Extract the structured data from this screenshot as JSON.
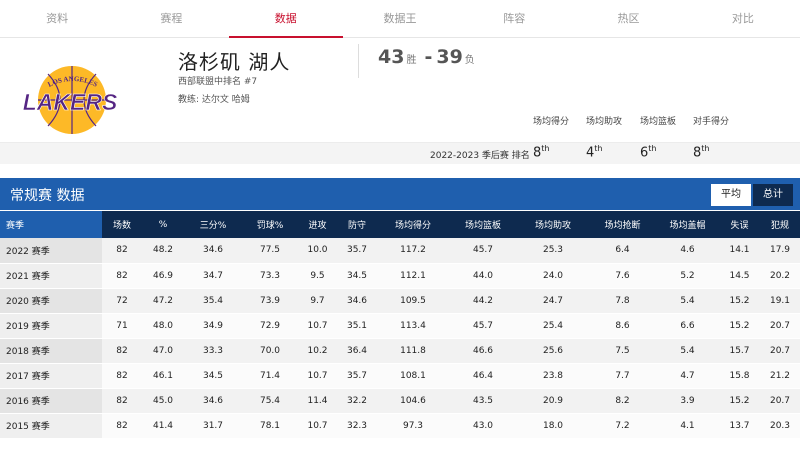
{
  "nav": {
    "tabs": [
      {
        "label": "资料"
      },
      {
        "label": "赛程"
      },
      {
        "label": "数据"
      },
      {
        "label": "数据王"
      },
      {
        "label": "阵容"
      },
      {
        "label": "热区"
      },
      {
        "label": "对比"
      }
    ],
    "active_index": 2
  },
  "header": {
    "team_name": "洛杉矶 湖人",
    "conference_rank": "西部联盟中排名 #7",
    "coach": "教练: 达尔文 哈姆",
    "wins": "43",
    "wins_unit": "胜",
    "separator": "-",
    "losses": "39",
    "losses_unit": "负",
    "logo_text_top": "LOS ANGELES",
    "logo_text_main": "LAKERS",
    "colors": {
      "accent": "#c8102e",
      "purple": "#552583",
      "gold": "#fdb927"
    }
  },
  "rankings": {
    "season_label": "2022-2023 季后赛 排名",
    "headers": [
      "场均得分",
      "场均助攻",
      "场均篮板",
      "对手得分"
    ],
    "values": [
      {
        "num": "8",
        "suffix": "th"
      },
      {
        "num": "4",
        "suffix": "th"
      },
      {
        "num": "6",
        "suffix": "th"
      },
      {
        "num": "8",
        "suffix": "th"
      }
    ]
  },
  "stats": {
    "title": "常规赛  数据",
    "toggle": [
      "平均",
      "总计"
    ],
    "toggle_active": 0,
    "colors": {
      "bar": "#1f5fae",
      "header": "#0e2a4f"
    },
    "columns": [
      "赛季",
      "场数",
      "%",
      "三分%",
      "罚球%",
      "进攻",
      "防守",
      "场均得分",
      "场均篮板",
      "场均助攻",
      "场均抢断",
      "场均盖帽",
      "失误",
      "犯规"
    ],
    "rows": [
      [
        "2022 赛季",
        "82",
        "48.2",
        "34.6",
        "77.5",
        "10.0",
        "35.7",
        "117.2",
        "45.7",
        "25.3",
        "6.4",
        "4.6",
        "14.1",
        "17.9"
      ],
      [
        "2021 赛季",
        "82",
        "46.9",
        "34.7",
        "73.3",
        "9.5",
        "34.5",
        "112.1",
        "44.0",
        "24.0",
        "7.6",
        "5.2",
        "14.5",
        "20.2"
      ],
      [
        "2020 赛季",
        "72",
        "47.2",
        "35.4",
        "73.9",
        "9.7",
        "34.6",
        "109.5",
        "44.2",
        "24.7",
        "7.8",
        "5.4",
        "15.2",
        "19.1"
      ],
      [
        "2019 赛季",
        "71",
        "48.0",
        "34.9",
        "72.9",
        "10.7",
        "35.1",
        "113.4",
        "45.7",
        "25.4",
        "8.6",
        "6.6",
        "15.2",
        "20.7"
      ],
      [
        "2018 赛季",
        "82",
        "47.0",
        "33.3",
        "70.0",
        "10.2",
        "36.4",
        "111.8",
        "46.6",
        "25.6",
        "7.5",
        "5.4",
        "15.7",
        "20.7"
      ],
      [
        "2017 赛季",
        "82",
        "46.1",
        "34.5",
        "71.4",
        "10.7",
        "35.7",
        "108.1",
        "46.4",
        "23.8",
        "7.7",
        "4.7",
        "15.8",
        "21.2"
      ],
      [
        "2016 赛季",
        "82",
        "45.0",
        "34.6",
        "75.4",
        "11.4",
        "32.2",
        "104.6",
        "43.5",
        "20.9",
        "8.2",
        "3.9",
        "15.2",
        "20.7"
      ],
      [
        "2015 赛季",
        "82",
        "41.4",
        "31.7",
        "78.1",
        "10.7",
        "32.3",
        "97.3",
        "43.0",
        "18.0",
        "7.2",
        "4.1",
        "13.7",
        "20.3"
      ]
    ]
  }
}
